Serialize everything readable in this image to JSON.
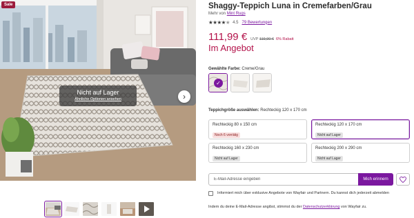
{
  "gallery": {
    "sale_badge": "Sale",
    "overlay_title": "Nicht auf Lager",
    "overlay_link": "Ähnliche Optionen ansehen",
    "next_icon": "chevron-right-icon"
  },
  "product": {
    "title": "Shaggy-Teppich Luna in Cremefarben/Grau",
    "brand_prefix": "Mehr von",
    "brand": "Mint Rugs",
    "rating_value": "4.5",
    "reviews": "79 Bewertungen",
    "price": "111,99 €",
    "uvp_label": "UVP",
    "uvp_price": "119,90 €",
    "discount": "6% Rabatt",
    "sale_text": "Im Angebot"
  },
  "color": {
    "label": "Gewählte Farbe:",
    "value": "Creme/Grau"
  },
  "size": {
    "label": "Teppichgröße auswählen:",
    "value": "Rechteckig 120 x 170 cm",
    "options": [
      {
        "name": "Rechteckig 80 x 150 cm",
        "badge": "Noch 6 vorrätig"
      },
      {
        "name": "Rechteckig 120 x 170 cm",
        "badge": "Nicht auf Lager"
      },
      {
        "name": "Rechteckig 160 x 230 cm",
        "badge": "Nicht auf Lager"
      },
      {
        "name": "Rechteckig 200 x 290 cm",
        "badge": "Nicht auf Lager"
      }
    ]
  },
  "notify": {
    "placeholder": "E-Mail-Adresse eingeben",
    "button": "Mich erinnern"
  },
  "optin_text": "Informiert mich über exklusive Angebote von Wayfair und Partnern. Du kannst dich jederzeit abmelden",
  "privacy": {
    "prefix": "Indem du deine E-Mail-Adresse angibst, stimmst du der",
    "link": "Datenschutzerklärung",
    "suffix": "von Wayfair zu."
  },
  "colors": {
    "accent": "#7b189f",
    "price": "#b3124a",
    "sale_badge": "#9c1c3c"
  }
}
